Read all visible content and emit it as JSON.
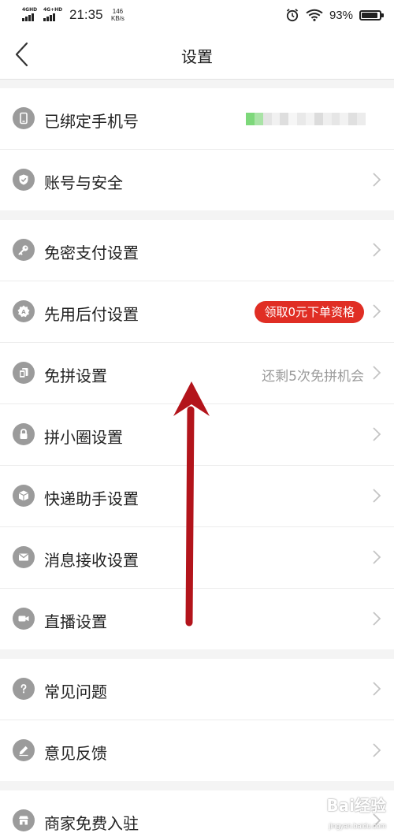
{
  "status_bar": {
    "sim1": "4GHD",
    "sim2": "4G+HD",
    "time": "21:35",
    "net_speed_value": "146",
    "net_speed_unit": "KB/s",
    "battery_percent": "93%",
    "battery_level": 0.93
  },
  "nav": {
    "title": "设置",
    "back_icon": "chevron-left-icon"
  },
  "groups": [
    {
      "rows": [
        {
          "label": "已绑定手机号",
          "icon": "phone-icon",
          "value_masked": true,
          "chevron": false
        },
        {
          "label": "账号与安全",
          "icon": "shield-icon",
          "chevron": true
        }
      ]
    },
    {
      "rows": [
        {
          "label": "免密支付设置",
          "icon": "key-icon",
          "chevron": true
        },
        {
          "label": "先用后付设置",
          "icon": "badge-icon",
          "badge": "领取0元下单资格",
          "chevron": true
        },
        {
          "label": "免拼设置",
          "icon": "cards-icon",
          "hint": "还剩5次免拼机会",
          "chevron": true
        },
        {
          "label": "拼小圈设置",
          "icon": "lock-icon",
          "chevron": true
        },
        {
          "label": "快递助手设置",
          "icon": "package-icon",
          "chevron": true
        },
        {
          "label": "消息接收设置",
          "icon": "mail-icon",
          "chevron": true
        },
        {
          "label": "直播设置",
          "icon": "video-camera-icon",
          "chevron": true
        }
      ]
    },
    {
      "rows": [
        {
          "label": "常见问题",
          "icon": "question-icon",
          "chevron": true
        },
        {
          "label": "意见反馈",
          "icon": "pencil-icon",
          "chevron": true
        }
      ]
    },
    {
      "rows": [
        {
          "label": "商家免费入驻",
          "icon": "store-icon",
          "chevron": true
        }
      ]
    }
  ],
  "watermark": {
    "brand": "Bai经验",
    "url": "jingyan.baidu.com"
  },
  "colors": {
    "accent": "#e02e24",
    "icon_gray": "#9b9b9b",
    "annotation_arrow": "#b3141b"
  }
}
